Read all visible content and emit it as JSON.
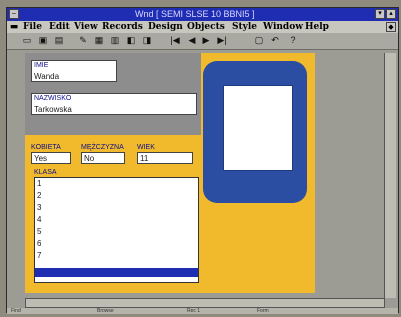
{
  "window": {
    "title": "Wnd [ SEMI SLSE 10 BBNI5 ]"
  },
  "menu": {
    "items": [
      "File",
      "Edit",
      "View",
      "Records",
      "Design",
      "Objects",
      "Style",
      "Window",
      "Help"
    ]
  },
  "toolbar": {
    "nav_first": "|◀",
    "nav_prev": "◀",
    "nav_next": "▶",
    "nav_last": "▶|"
  },
  "form": {
    "imie": {
      "label": "IMIE",
      "value": "Wanda"
    },
    "nazwisko": {
      "label": "NAZWISKO",
      "value": "Tarkowska"
    },
    "kobieta": {
      "label": "KOBIETA",
      "value": "Yes"
    },
    "mezczyzna": {
      "label": "MĘŻCZYZNA",
      "value": "No"
    },
    "wiek": {
      "label": "WIEK",
      "value": "11"
    },
    "klasa": {
      "label": "KLASA",
      "options": [
        "1",
        "2",
        "3",
        "4",
        "5",
        "6",
        "7",
        ""
      ]
    }
  },
  "status": {
    "left": "Find",
    "mid1": "Browse",
    "mid2": "Rec 1",
    "right": "Form"
  }
}
